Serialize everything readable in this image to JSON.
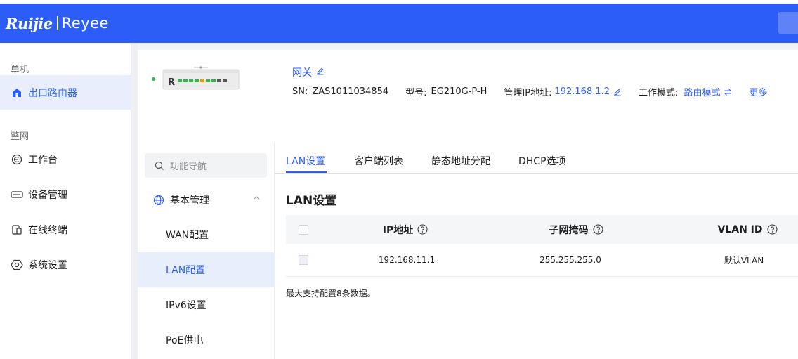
{
  "brand": {
    "logo_main": "Ruijie",
    "logo_sub": "Reyee"
  },
  "sidebar": {
    "groups": [
      {
        "title": "单机",
        "items": [
          {
            "label": "出口路由器",
            "icon": "home-icon",
            "active": true
          }
        ]
      },
      {
        "title": "整网",
        "items": [
          {
            "label": "工作台",
            "icon": "dashboard-icon",
            "active": false
          },
          {
            "label": "设备管理",
            "icon": "device-icon",
            "active": false
          },
          {
            "label": "在线终端",
            "icon": "terminal-icon",
            "active": false
          },
          {
            "label": "系统设置",
            "icon": "settings-icon",
            "active": false
          }
        ]
      }
    ]
  },
  "device": {
    "name": "网关",
    "sn_label": "SN:",
    "sn": "ZAS1011034854",
    "model_label": "型号:",
    "model": "EG210G-P-H",
    "ip_label": "管理IP地址:",
    "ip": "192.168.1.2",
    "mode_label": "工作模式:",
    "mode": "路由模式",
    "more": "更多"
  },
  "subnav": {
    "search_placeholder": "功能导航",
    "group": "基本管理",
    "items": [
      {
        "label": "WAN配置",
        "active": false
      },
      {
        "label": "LAN配置",
        "active": true
      },
      {
        "label": "IPv6设置",
        "active": false
      },
      {
        "label": "PoE供电",
        "active": false
      }
    ]
  },
  "tabs": [
    {
      "label": "LAN设置",
      "active": true
    },
    {
      "label": "客户端列表",
      "active": false
    },
    {
      "label": "静态地址分配",
      "active": false
    },
    {
      "label": "DHCP选项",
      "active": false
    }
  ],
  "section_title": "LAN设置",
  "table": {
    "headers": {
      "ip": "IP地址",
      "mask": "子网掩码",
      "vlan": "VLAN ID"
    },
    "rows": [
      {
        "ip": "192.168.11.1",
        "mask": "255.255.255.0",
        "vlan": "默认VLAN"
      }
    ]
  },
  "note": "最大支持配置8条数据。",
  "colors": {
    "primary": "#2c5ef7",
    "active_bg": "#e8eefc",
    "online": "#2db84d"
  }
}
